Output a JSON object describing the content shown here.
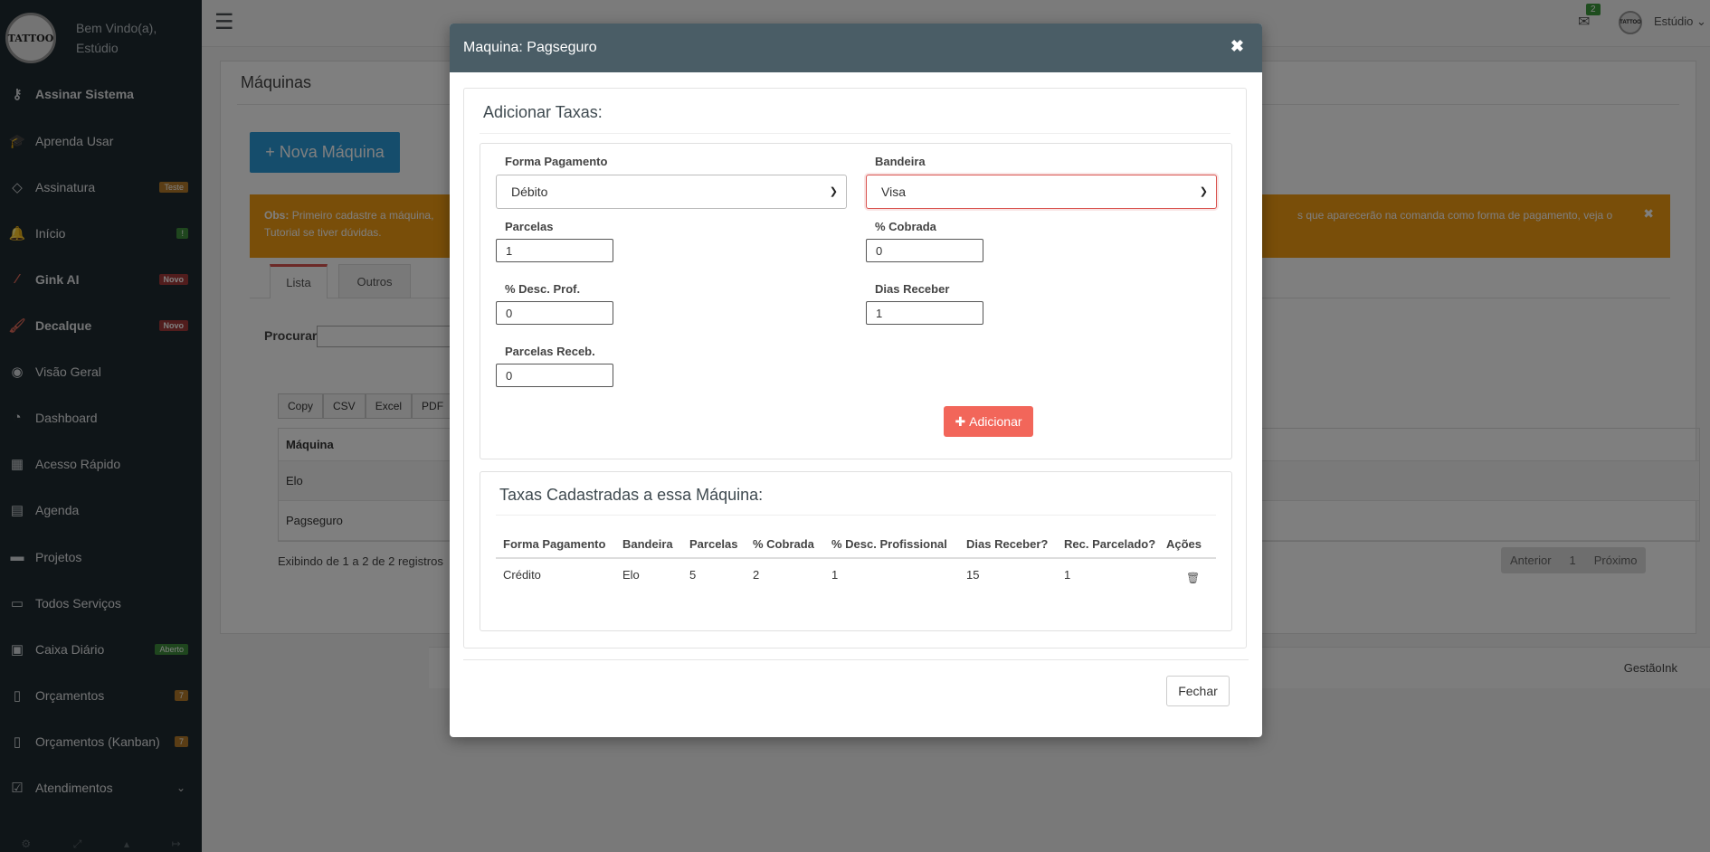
{
  "sidebar": {
    "logo_text": "TATTOO",
    "welcome_line1": "Bem Vindo(a),",
    "welcome_line2": "Estúdio",
    "items": [
      {
        "label": "Assinar Sistema",
        "icon": "key-icon",
        "glyph": "⚷"
      },
      {
        "label": "Aprenda Usar",
        "icon": "graduation-cap-icon",
        "glyph": "🎓"
      },
      {
        "label": "Assinatura",
        "icon": "diamond-icon",
        "glyph": "◇",
        "badge": "Teste"
      },
      {
        "label": "Início",
        "icon": "bell-icon",
        "glyph": "🔔",
        "badge": "!"
      },
      {
        "label": "Gink AI",
        "icon": "magic-wand-icon",
        "glyph": "⁄",
        "badge": "Novo"
      },
      {
        "label": "Decalque",
        "icon": "brush-icon",
        "glyph": "🖌",
        "badge": "Novo"
      },
      {
        "label": "Visão Geral",
        "icon": "eye-icon",
        "glyph": "◉"
      },
      {
        "label": "Dashboard",
        "icon": "dashboard-icon",
        "glyph": "◔"
      },
      {
        "label": "Acesso Rápido",
        "icon": "grid-icon",
        "glyph": "▦"
      },
      {
        "label": "Agenda",
        "icon": "calendar-icon",
        "glyph": "▤"
      },
      {
        "label": "Projetos",
        "icon": "folder-icon",
        "glyph": "▬"
      },
      {
        "label": "Todos Serviços",
        "icon": "folder-open-icon",
        "glyph": "▭"
      },
      {
        "label": "Caixa Diário",
        "icon": "money-icon",
        "glyph": "▣",
        "badge": "Aberto"
      },
      {
        "label": "Orçamentos",
        "icon": "document-icon",
        "glyph": "▯",
        "badge": "7"
      },
      {
        "label": "Orçamentos (Kanban)",
        "icon": "document-icon",
        "glyph": "▯",
        "badge": "7"
      },
      {
        "label": "Atendimentos",
        "icon": "check-square-icon",
        "glyph": "☑",
        "chevron": "⌄"
      }
    ]
  },
  "topbar": {
    "mail_count": "2",
    "user_avatar": "TATTOO",
    "user_name": "Estúdio ⌄"
  },
  "page": {
    "title": "Máquinas",
    "new_button": "+ Nova Máquina",
    "obs_label": "Obs:",
    "obs_text_start": "Primeiro cadastre a máquina,",
    "obs_text_end": "s que aparecerão na comanda como forma de pagamento, veja o",
    "obs_text_line2": "Tutorial se tiver dúvidas.",
    "tabs": [
      "Lista",
      "Outros"
    ],
    "search_label": "Procurar",
    "export_buttons": [
      "Copy",
      "CSV",
      "Excel",
      "PDF"
    ],
    "table_header": "Máquina",
    "rows": [
      "Elo",
      "Pagseguro"
    ],
    "showing": "Exibindo de 1 a 2 de 2 registros",
    "pager": [
      "Anterior",
      "1",
      "Próximo"
    ],
    "footer_brand": "GestãoInk"
  },
  "modal": {
    "title": "Maquina: Pagseguro",
    "section_title": "Adicionar Taxas:",
    "form": {
      "payment_label": "Forma Pagamento",
      "payment_value": "Débito",
      "flag_label": "Bandeira",
      "flag_value": "Visa",
      "installments_label": "Parcelas",
      "installments_value": "1",
      "charged_label": "% Cobrada",
      "charged_value": "0",
      "prof_discount_label": "% Desc. Prof.",
      "prof_discount_value": "0",
      "days_label": "Dias Receber",
      "days_value": "1",
      "receipt_installments_label": "Parcelas Receb.",
      "receipt_installments_value": "0",
      "add_button": "Adicionar"
    },
    "rates": {
      "title": "Taxas Cadastradas a essa Máquina:",
      "columns": [
        "Forma Pagamento",
        "Bandeira",
        "Parcelas",
        "% Cobrada",
        "% Desc. Profissional",
        "Dias Receber?",
        "Rec. Parcelado?",
        "Ações"
      ],
      "rows": [
        [
          "Crédito",
          "Elo",
          "5",
          "2",
          "1",
          "15",
          "1"
        ]
      ]
    },
    "close_button": "Fechar"
  },
  "colors": {
    "sidebar_bg": "#1f2a30",
    "modal_header": "#4a5d66",
    "primary": "#2a9ad8",
    "warning": "#f39c12",
    "danger": "#f2665a"
  }
}
